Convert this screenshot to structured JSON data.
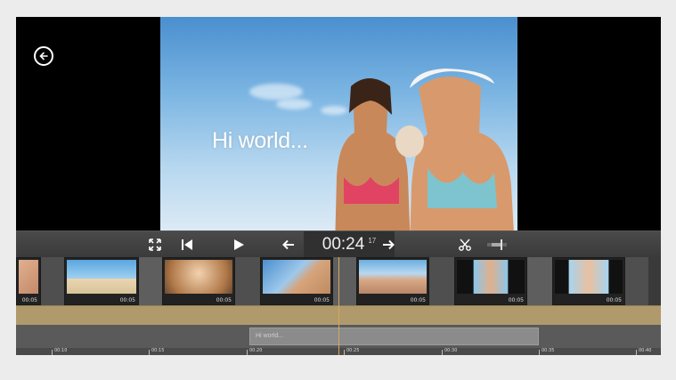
{
  "preview": {
    "overlay_text": "Hi world..."
  },
  "controls": {
    "timecode_main": "00:24",
    "timecode_frames": "17"
  },
  "clips": [
    {
      "duration": "00:05"
    },
    {
      "duration": "00:05"
    },
    {
      "duration": "00:05"
    },
    {
      "duration": "00:05"
    },
    {
      "duration": "00:05"
    },
    {
      "duration": "00:05"
    },
    {
      "duration": "00:05"
    }
  ],
  "title_track": {
    "label": "Hi world..."
  },
  "ruler": {
    "labels": [
      "00:10",
      "00:15",
      "00:20",
      "00:25",
      "00:30",
      "00:35",
      "00:40"
    ]
  },
  "colors": {
    "accent_playhead": "#d8a75a",
    "audio_track": "#b09a6c"
  }
}
